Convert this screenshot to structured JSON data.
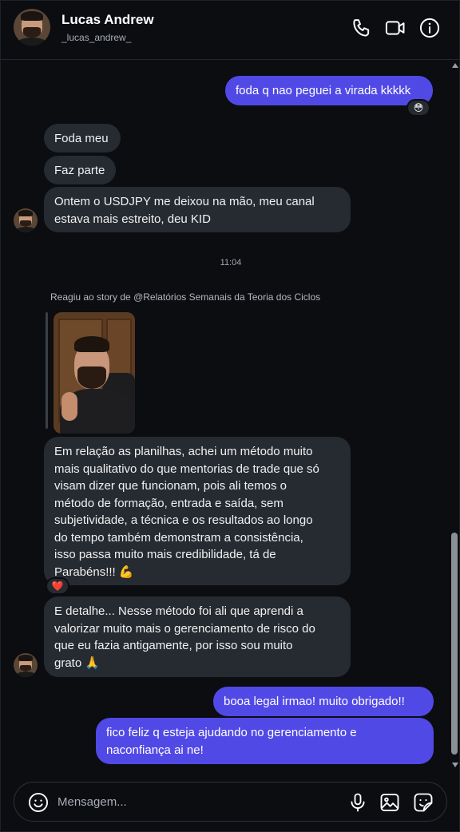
{
  "contact": {
    "name": "Lucas Andrew",
    "handle": "_lucas_andrew_"
  },
  "header_icons": [
    "phone-icon",
    "video-call-icon",
    "info-icon"
  ],
  "messages": [
    {
      "from": "me",
      "text": "foda q nao peguei a virada kkkkk",
      "reaction": "😳"
    },
    {
      "from": "them",
      "text": "Foda meu"
    },
    {
      "from": "them",
      "text": "Faz parte"
    },
    {
      "from": "them",
      "text": "Ontem o USDJPY me deixou na mão, meu canal\nestava mais estreito, deu KID"
    },
    {
      "from": "them",
      "text": "Em relação as planilhas, achei um método muito\nmais qualitativo do que mentorias de trade que só\nvisam dizer que funcionam, pois ali temos o\nmétodo de formação, entrada e saída, sem\nsubjetividade, a técnica e os resultados ao longo\ndo tempo também demonstram a consistência,\nisso passa muito mais credibilidade, tá de\nParabéns!!! 💪",
      "reaction": "❤️"
    },
    {
      "from": "them",
      "text": "E detalhe... Nesse método foi ali que aprendi a\nvalorizar muito mais o gerenciamento de risco do\nque eu fazia antigamente, por isso sou muito\ngrato 🙏"
    },
    {
      "from": "me",
      "text": "booa legal irmao! muito obrigado!!"
    },
    {
      "from": "me",
      "text": "fico feliz q esteja ajudando no gerenciamento e\nnaconfiança ai ne!"
    }
  ],
  "timestamp": "11:04",
  "story_caption": "Reagiu ao story de @Relatórios Semanais da Teoria dos Ciclos",
  "composer": {
    "placeholder": "Mensagem..."
  },
  "colors": {
    "background": "#0b0d11",
    "incoming_bubble": "#262a31",
    "outgoing_bubble": "#5149e6"
  }
}
